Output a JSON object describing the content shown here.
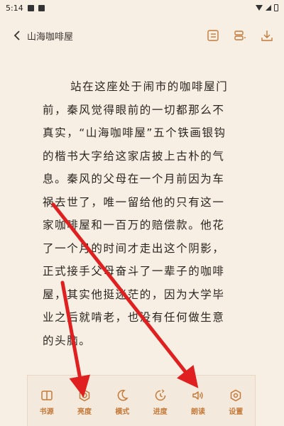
{
  "status_bar": {
    "time": "5:14"
  },
  "header": {
    "title": "山海咖啡屋"
  },
  "book": {
    "lines": [
      "站在这座处于闹市的咖啡屋门",
      "前，秦风觉得眼前的一切都那么不",
      "真实，“山海咖啡屋”五个铁画银钩",
      "的楷书大字给这家店披上古朴的气",
      "息。秦风的父母在一个月前因为车",
      "祸去世了，唯一留给他的只有这一",
      "家咖啡屋和一百万的赔偿款。他花",
      "了一个月的时间才走出这个阴影，",
      "正式接手父母奋斗了一辈子的咖啡",
      "屋，其实他挺迷茫的，因为大学毕",
      "业之后就啃老，也没有任何做生意",
      "的头脑。"
    ]
  },
  "bottom_toolbar": {
    "items": [
      {
        "label": "书源",
        "icon": "book-source-icon"
      },
      {
        "label": "亮度",
        "icon": "brightness-icon"
      },
      {
        "label": "模式",
        "icon": "moon-icon"
      },
      {
        "label": "进度",
        "icon": "progress-icon"
      },
      {
        "label": "朗读",
        "icon": "read-aloud-icon"
      },
      {
        "label": "设置",
        "icon": "settings-icon"
      }
    ]
  },
  "colors": {
    "accent": "#c47a3a",
    "background": "#f7efe3",
    "arrow": "#e02020"
  }
}
